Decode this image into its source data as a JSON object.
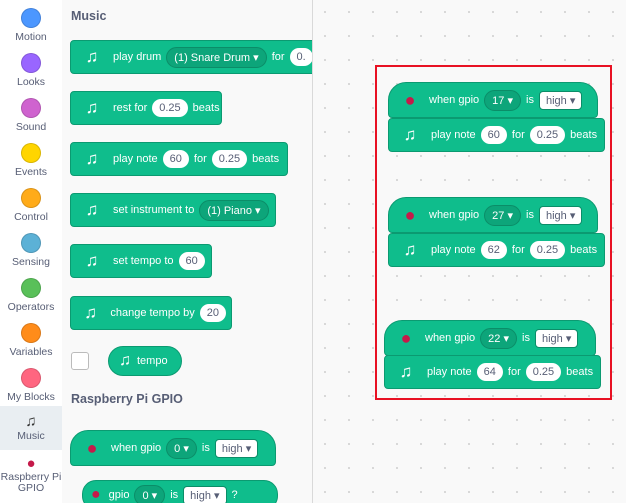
{
  "categories": [
    {
      "label": "Motion",
      "color": "#4c97ff"
    },
    {
      "label": "Looks",
      "color": "#9966ff"
    },
    {
      "label": "Sound",
      "color": "#cf63cf"
    },
    {
      "label": "Events",
      "color": "#ffd500"
    },
    {
      "label": "Control",
      "color": "#ffab19"
    },
    {
      "label": "Sensing",
      "color": "#5cb1d6"
    },
    {
      "label": "Operators",
      "color": "#59c059"
    },
    {
      "label": "Variables",
      "color": "#ff8c1a"
    },
    {
      "label": "My Blocks",
      "color": "#ff6680"
    },
    {
      "label": "Music",
      "color": "#0fbd8c",
      "selected": true
    },
    {
      "label": "Raspberry Pi GPIO",
      "color": "#c51a4a"
    }
  ],
  "palette": {
    "music_title": "Music",
    "play_drum": {
      "text": "play drum",
      "drum": "(1) Snare Drum",
      "for": "for",
      "beats": "0."
    },
    "rest_for": {
      "text": "rest for",
      "value": "0.25",
      "beats": "beats"
    },
    "play_note": {
      "text": "play note",
      "note": "60",
      "for": "for",
      "value": "0.25",
      "beats": "beats"
    },
    "set_instrument": {
      "text": "set instrument to",
      "value": "(1) Piano"
    },
    "set_tempo": {
      "text": "set tempo to",
      "value": "60"
    },
    "change_tempo": {
      "text": "change tempo by",
      "value": "20"
    },
    "tempo": {
      "text": "tempo"
    },
    "gpio_title": "Raspberry Pi GPIO",
    "when_gpio": {
      "text": "when gpio",
      "pin": "0",
      "is": "is",
      "state": "high"
    },
    "gpio_bool": {
      "text": "gpio",
      "pin": "0",
      "is": "is",
      "state": "high",
      "q": "?"
    }
  },
  "scripts": [
    {
      "when": "when gpio",
      "pin": "17",
      "is": "is",
      "state": "high",
      "play": "play note",
      "note": "60",
      "for": "for",
      "beats_val": "0.25",
      "beats": "beats"
    },
    {
      "when": "when gpio",
      "pin": "27",
      "is": "is",
      "state": "high",
      "play": "play note",
      "note": "62",
      "for": "for",
      "beats_val": "0.25",
      "beats": "beats"
    },
    {
      "when": "when gpio",
      "pin": "22",
      "is": "is",
      "state": "high",
      "play": "play note",
      "note": "64",
      "for": "for",
      "beats_val": "0.25",
      "beats": "beats"
    }
  ]
}
